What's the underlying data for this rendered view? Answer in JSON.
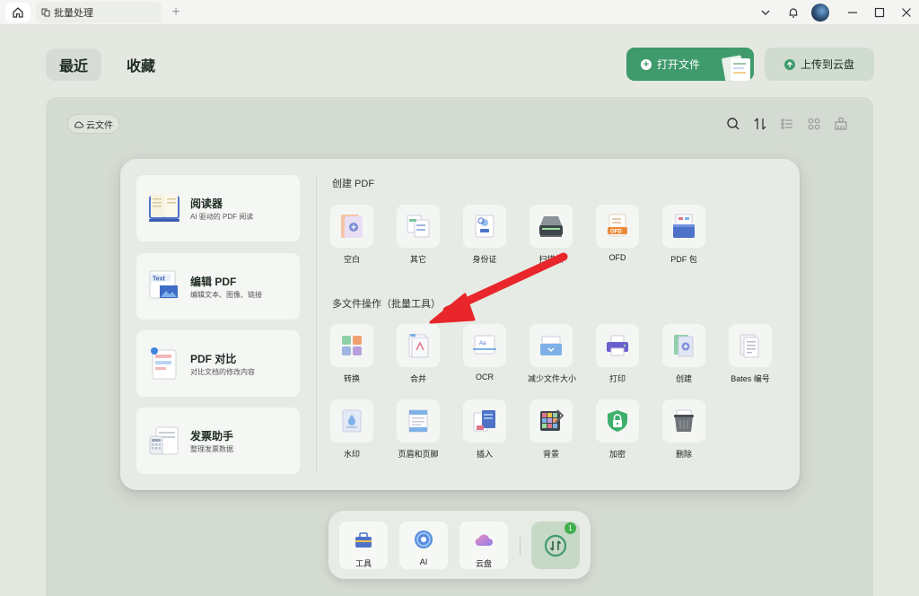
{
  "titlebar": {
    "tab_title": "批量处理",
    "new_tab_symbol": "+",
    "icons": [
      "home-icon",
      "batch-icon",
      "chevron-down-icon",
      "bell-icon",
      "avatar",
      "minimize-icon",
      "maximize-icon",
      "close-icon"
    ]
  },
  "header": {
    "tab_recent": "最近",
    "tab_favorites": "收藏",
    "open_file": "打开文件",
    "upload_cloud": "上传到云盘"
  },
  "toolbar": {
    "cloud_files": "云文件"
  },
  "left_items": [
    {
      "title": "阅读器",
      "subtitle": "AI 驱动的 PDF 阅读"
    },
    {
      "title": "编辑 PDF",
      "subtitle": "编辑文本、图像、链接"
    },
    {
      "title": "PDF 对比",
      "subtitle": "对比文档的修改内容"
    },
    {
      "title": "发票助手",
      "subtitle": "整理发票数据"
    }
  ],
  "create_section": {
    "title": "创建 PDF",
    "items": [
      "空白",
      "其它",
      "身份证",
      "扫描仪",
      "OFD",
      "PDF 包"
    ]
  },
  "batch_section": {
    "title": "多文件操作（批量工具）",
    "row1": [
      "转换",
      "合并",
      "OCR",
      "减少文件大小",
      "打印",
      "创建",
      "Bates 编号"
    ],
    "row2": [
      "水印",
      "页眉和页脚",
      "插入",
      "背景",
      "加密",
      "删除"
    ]
  },
  "dock": {
    "tools": "工具",
    "ai": "AI",
    "cloud": "云盘",
    "badge": "1"
  },
  "colors": {
    "accent_green": "#3f9a6c",
    "arrow_red": "#e8262b"
  }
}
